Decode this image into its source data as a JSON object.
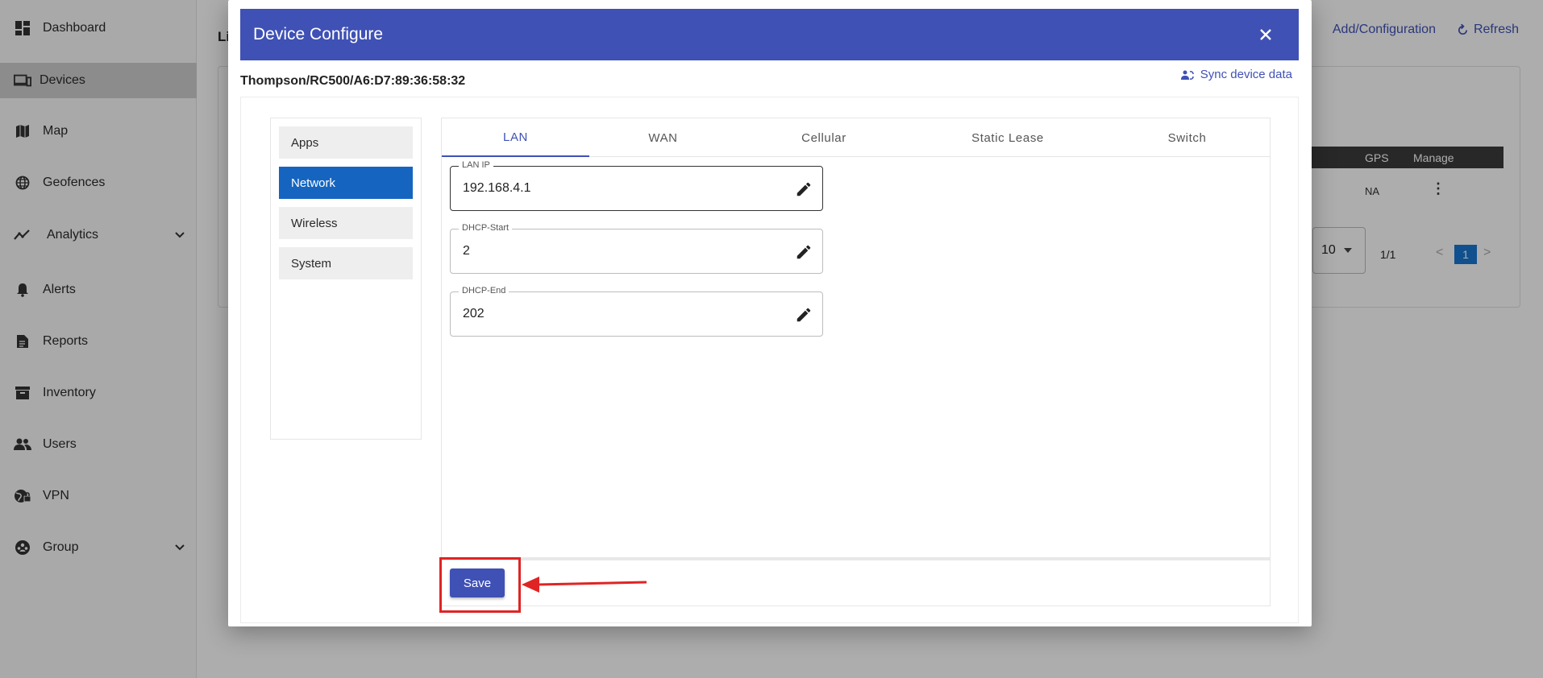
{
  "sidebar": {
    "items": [
      {
        "label": "Dashboard",
        "icon": "dashboard-icon"
      },
      {
        "label": "Devices",
        "icon": "devices-icon",
        "active": true
      },
      {
        "label": "Map",
        "icon": "map-icon"
      },
      {
        "label": "Geofences",
        "icon": "geofence-icon"
      },
      {
        "label": "Analytics",
        "icon": "analytics-icon",
        "expandable": true
      },
      {
        "label": "Alerts",
        "icon": "bell-icon"
      },
      {
        "label": "Reports",
        "icon": "report-icon"
      },
      {
        "label": "Inventory",
        "icon": "archive-icon"
      },
      {
        "label": "Users",
        "icon": "users-icon"
      },
      {
        "label": "VPN",
        "icon": "vpn-icon"
      },
      {
        "label": "Group",
        "icon": "group-icon",
        "expandable": true
      }
    ]
  },
  "background": {
    "list_title": "Li",
    "actions": {
      "add_config": "Add/Configuration",
      "refresh": "Refresh"
    },
    "table_headers": {
      "gps": "GPS",
      "manage": "Manage"
    },
    "row": {
      "gps": "NA"
    },
    "pager": {
      "rows_per_page": "10",
      "page_info": "1/1",
      "prev": "<",
      "current": "1",
      "next": ">"
    }
  },
  "modal": {
    "title": "Device Configure",
    "device_id": "Thompson/RC500/A6:D7:89:36:58:32",
    "sync_label": "Sync device data",
    "side_menu": [
      {
        "label": "Apps"
      },
      {
        "label": "Network",
        "active": true
      },
      {
        "label": "Wireless"
      },
      {
        "label": "System"
      }
    ],
    "tabs": [
      {
        "label": "LAN",
        "active": true
      },
      {
        "label": "WAN"
      },
      {
        "label": "Cellular"
      },
      {
        "label": "Static Lease"
      },
      {
        "label": "Switch"
      }
    ],
    "fields": {
      "lan_ip": {
        "label": "LAN IP",
        "value": "192.168.4.1"
      },
      "dhcp_start": {
        "label": "DHCP-Start",
        "value": "2"
      },
      "dhcp_end": {
        "label": "DHCP-End",
        "value": "202"
      }
    },
    "save_label": "Save"
  },
  "colors": {
    "primary": "#3f51b5",
    "active_menu": "#1565c0",
    "annotation": "#e02424"
  }
}
